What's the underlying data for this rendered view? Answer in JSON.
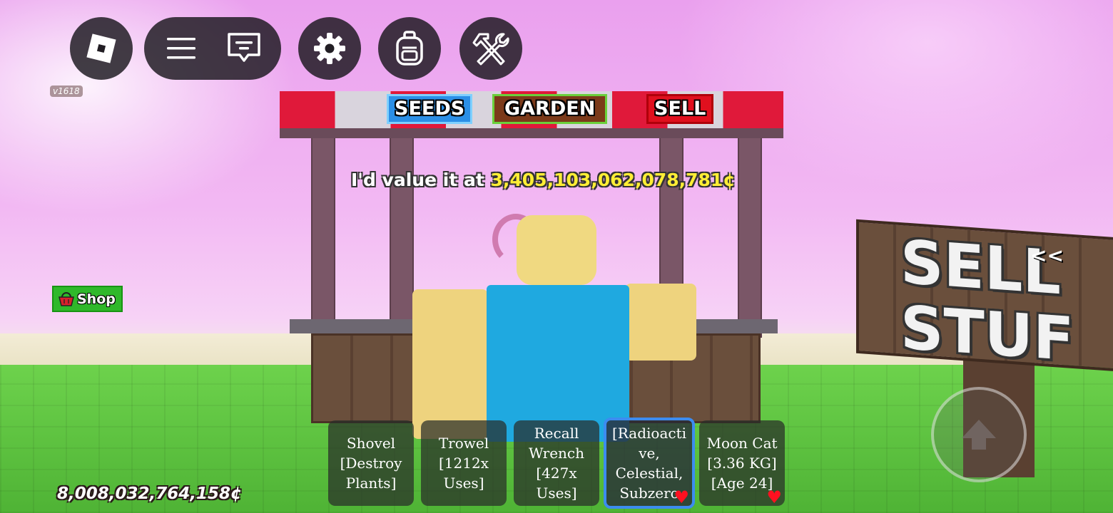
{
  "hud": {
    "version": "v1618",
    "shop_label": "Shop",
    "money": "8,008,032,764,158¢"
  },
  "stall": {
    "signs": [
      "SEEDS",
      "GARDEN",
      "SELL"
    ],
    "value_prefix": "I'd value it at ",
    "value_amount": "3,405,103,062,078,781¢"
  },
  "billboard": {
    "text": "SELL\nSTUF",
    "arrow": "<<"
  },
  "hotbar": [
    {
      "label": "Shovel\n[Destroy\nPlants]",
      "selected": false,
      "favorite": false
    },
    {
      "label": "Trowel\n[1212x\nUses]",
      "selected": false,
      "favorite": false
    },
    {
      "label": "Recall\nWrench\n[427x\nUses]",
      "selected": false,
      "favorite": false
    },
    {
      "label": "[Radioacti\nve,\nCelestial,\nSubzero",
      "selected": true,
      "favorite": true
    },
    {
      "label": "Moon Cat\n[3.36 KG]\n[Age 24]",
      "selected": false,
      "favorite": true
    }
  ],
  "icons": [
    "roblox-logo-icon",
    "menu-icon",
    "chat-icon",
    "settings-gear-icon",
    "backpack-icon",
    "build-tools-icon",
    "jump-arrow-icon",
    "shop-basket-icon",
    "heart-icon"
  ],
  "colors": {
    "accent_selected": "#3c8cf0",
    "money_yellow": "#ffee35",
    "shop_green": "#2fb82a"
  }
}
